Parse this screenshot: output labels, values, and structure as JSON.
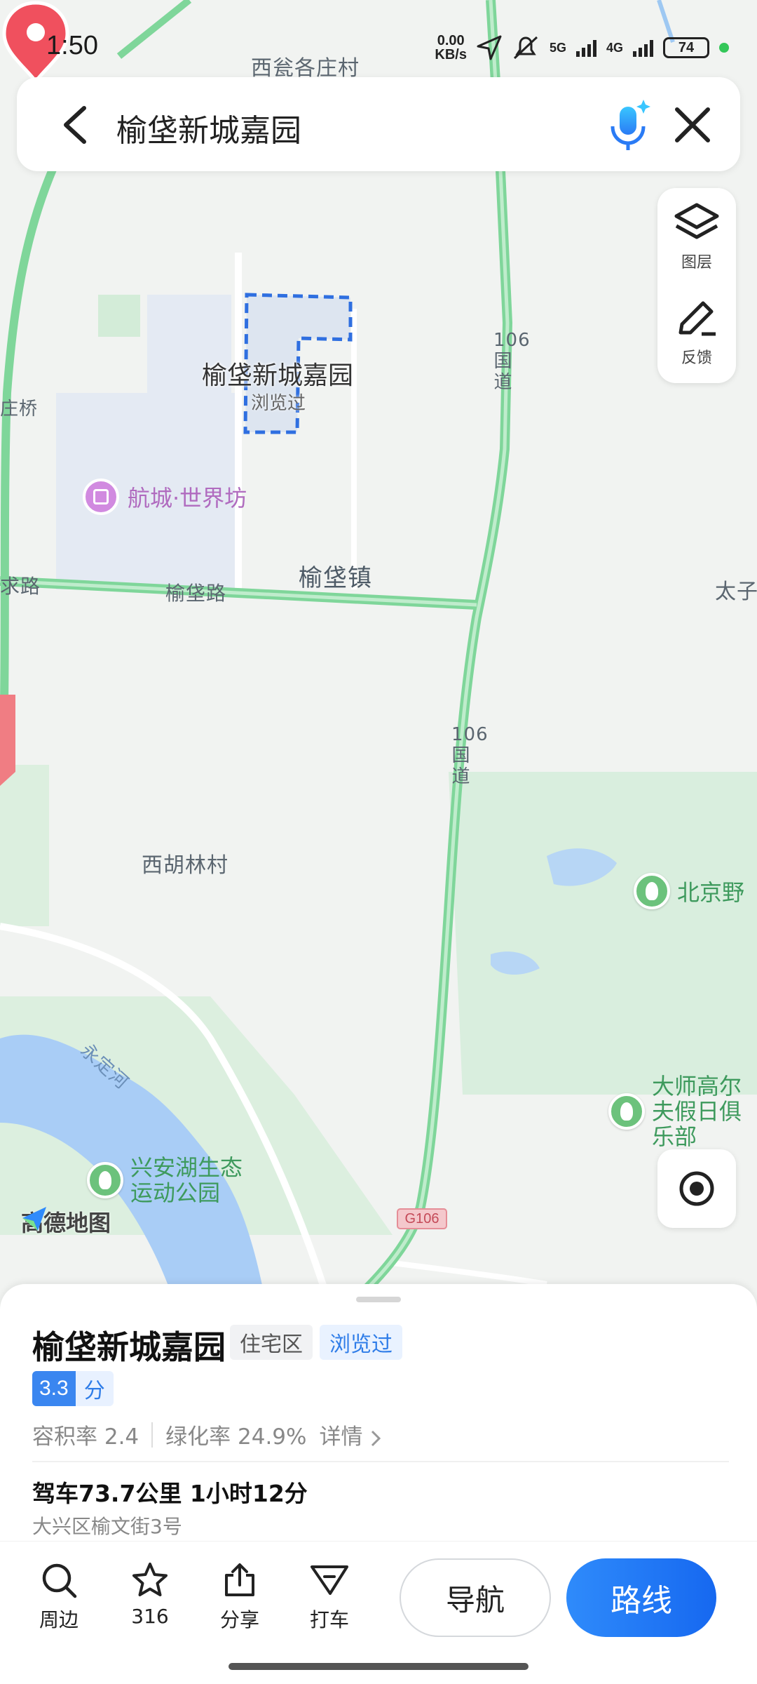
{
  "status": {
    "time": "1:50",
    "net_speed_value": "0.00",
    "net_speed_unit": "KB/s",
    "sig1_label": "5G",
    "sig2_label": "4G",
    "battery": "74"
  },
  "search": {
    "query": "榆垡新城嘉园"
  },
  "tools": {
    "layers_label": "图层",
    "feedback_label": "反馈"
  },
  "map": {
    "labels": {
      "village_top": "西瓮各庄村",
      "bridge": "庄桥",
      "yufa_road": "榆垡路",
      "left_road": "求路",
      "town": "榆垡镇",
      "taizi": "太子",
      "xihulin": "西胡林村",
      "road106_a": "106国道",
      "road106_b": "106国道",
      "river": "永定河",
      "g106": "G106"
    },
    "pin": {
      "title": "榆垡新城嘉园",
      "subtitle": "浏览过"
    },
    "pois": {
      "mall": "航城·世界坊",
      "wild": "北京野",
      "golf": "大师高尔夫假日俱乐部",
      "park_line1": "兴安湖生态",
      "park_line2": "运动公园"
    },
    "logo": "高德地图"
  },
  "place": {
    "name": "榆垡新城嘉园",
    "type_tag": "住宅区",
    "visited_tag": "浏览过",
    "score": "3.3",
    "score_unit": "分",
    "plot_ratio": "容积率 2.4",
    "green_ratio": "绿化率 24.9%",
    "detail": "详情",
    "drive": "驾车73.7公里 1小时12分",
    "address": "大兴区榆文街3号"
  },
  "toolbar": {
    "nearby": "周边",
    "favorites": "316",
    "share": "分享",
    "taxi": "打车",
    "navigate": "导航",
    "route": "路线"
  },
  "colors": {
    "accent": "#1668f0",
    "road_green": "#7fd69a",
    "pin_red": "#f0505e"
  }
}
